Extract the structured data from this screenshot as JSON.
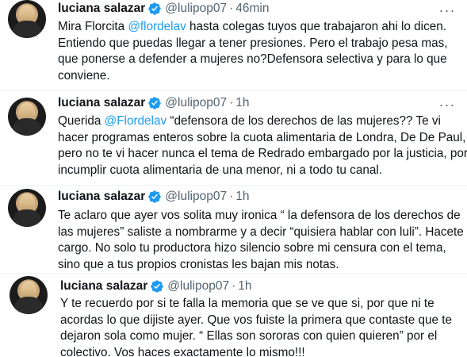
{
  "tweets": [
    {
      "name": "luciana salazar",
      "handle": "@lulipop07",
      "separator": "·",
      "time": "46min",
      "more": "···",
      "lines": [
        [
          "Mira Florcita ",
          "@flordelav",
          " hasta colegas tuyos que trabajaron ahi lo dicen."
        ],
        [
          "Entiendo que puedas llegar a tener presiones. Pero el trabajo pesa mas,"
        ],
        [
          "que ponerse a defender a mujeres no?Defensora selectiva y para lo que"
        ],
        [
          "conviene."
        ]
      ]
    },
    {
      "name": "luciana salazar",
      "handle": "@lulipop07",
      "separator": "·",
      "time": "1h",
      "more": "···",
      "lines": [
        [
          "Querida ",
          "@Flordelav",
          " “defensora de los derechos de las mujeres?? Te vi"
        ],
        [
          "hacer programas enteros sobre la cuota alimentaria de Londra, De De Paul,"
        ],
        [
          "pero no te vi hacer nunca el tema de Redrado embargado por la justicia, por"
        ],
        [
          "incumplir cuota alimentaria de una menor, ni a todo tu canal."
        ]
      ]
    },
    {
      "name": "luciana salazar",
      "handle": "@lulipop07",
      "separator": "·",
      "time": "1h",
      "more": "···",
      "lines": [
        [
          "Te aclaro que ayer vos solita muy ironica “ la defensora de los derechos de"
        ],
        [
          "las mujeres” saliste a nombrarme y a decir “quisiera hablar con luli”. Hacete"
        ],
        [
          "cargo. No solo tu productora hizo silencio sobre mi censura con el tema,"
        ],
        [
          "sino que a tus propios cronistas les bajan mis notas."
        ]
      ]
    },
    {
      "name": "luciana salazar",
      "handle": "@lulipop07",
      "separator": "·",
      "time": "1h",
      "more": "···",
      "lines": [
        [
          "Y te recuerdo por si te falla la memoria que se ve que si, por que ni te"
        ],
        [
          "acordas lo que dijiste ayer. Que vos fuiste la primera que contaste que te"
        ],
        [
          "dejaron sola como mujer. “ Ellas son sororas con quien quieren” por el"
        ],
        [
          "colectivo. Vos haces exactamente lo mismo!!!"
        ]
      ]
    }
  ]
}
